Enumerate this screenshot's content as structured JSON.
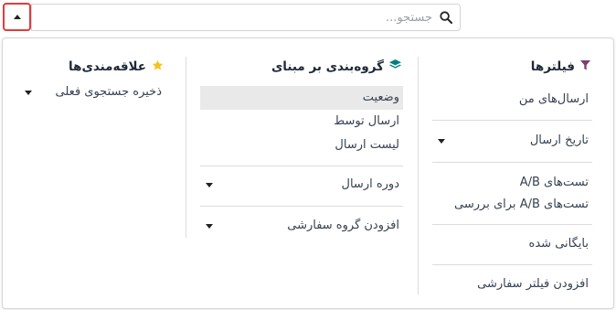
{
  "search": {
    "placeholder": "جستجو..."
  },
  "filters": {
    "title": "فیلترها",
    "items": {
      "my_sendings": "ارسال‌های من",
      "send_date": "تاریخ ارسال",
      "ab_tests": "تست‌های A/B",
      "ab_tests_review": "تست‌های A/B برای بررسی",
      "archived": "بایگانی شده",
      "add_custom_filter": "افزودن فیلتر سفارشی"
    }
  },
  "group_by": {
    "title": "گروه‌بندی بر مبنای",
    "items": {
      "status": "وضعیت",
      "sent_by": "ارسال توسط",
      "send_list": "لیست ارسال",
      "send_period": "دوره ارسال",
      "add_custom_group": "افزودن گروه سفارشی"
    }
  },
  "favorites": {
    "title": "علاقه‌مندی‌ها",
    "items": {
      "save_current_search": "ذخیره جستجوی فعلی"
    }
  },
  "colors": {
    "filter_icon": "#7c3f6e",
    "groupby_icon": "#017e84",
    "star_icon": "#f3c31b",
    "toggle_border": "#e23b3b"
  }
}
